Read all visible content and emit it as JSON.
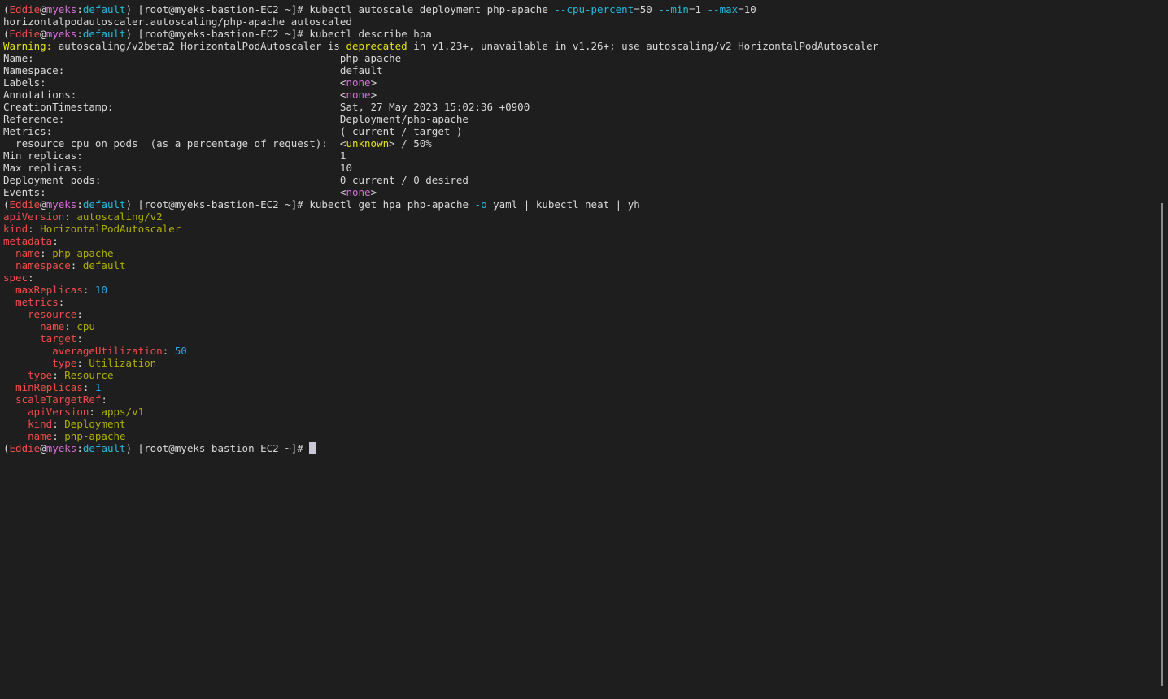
{
  "terminal": {
    "prompt": {
      "open": "(",
      "user": "Eddie",
      "at": "@",
      "cluster": "myeks",
      "colon": ":",
      "namespace": "default",
      "close_path": ") [root@myeks-bastion-EC2 ~]# "
    },
    "cmd1": {
      "base": "kubectl autoscale deployment php-apache ",
      "flag1": "--cpu-percent",
      "val1": "=50 ",
      "flag2": "--min",
      "val2": "=1 ",
      "flag3": "--max",
      "val3": "=10"
    },
    "cmd1_output": "horizontalpodautoscaler.autoscaling/php-apache autoscaled",
    "cmd2": "kubectl describe hpa",
    "warning": {
      "label": "Warning:",
      "text1": " autoscaling/v2beta2 HorizontalPodAutoscaler is ",
      "deprecated": "deprecated",
      "text2": " in v1.23+, unavailable in v1.26+; use autoscaling/v2 HorizontalPodAutoscaler"
    },
    "describe": {
      "name_key": "Name:",
      "name_val": "php-apache",
      "namespace_key": "Namespace:",
      "namespace_val": "default",
      "labels_key": "Labels:",
      "annotations_key": "Annotations:",
      "none_lt": "<",
      "none_word": "none",
      "none_gt": ">",
      "created_key": "CreationTimestamp:",
      "created_val": "Sat, 27 May 2023 15:02:36 +0900",
      "reference_key": "Reference:",
      "reference_val": "Deployment/php-apache",
      "metrics_key": "Metrics:",
      "metrics_val": "( current / target )",
      "resource_key": "  resource cpu on pods  (as a percentage of request):",
      "resource_lt": "<",
      "resource_unknown": "unknown",
      "resource_rest": "> / 50%",
      "min_key": "Min replicas:",
      "min_val": "1",
      "max_key": "Max replicas:",
      "max_val": "10",
      "deploy_pods_key": "Deployment pods:",
      "deploy_pods_val": "0 current / 0 desired",
      "events_key": "Events:"
    },
    "cmd3": {
      "base": "kubectl get hpa php-apache ",
      "flag": "-o",
      "rest": " yaml | kubectl neat | yh"
    },
    "yaml": {
      "apiVersion_key": "apiVersion",
      "apiVersion_val": "autoscaling/v2",
      "kind_key": "kind",
      "kind_val": "HorizontalPodAutoscaler",
      "metadata_key": "metadata",
      "name_key": "name",
      "name_val": "php-apache",
      "namespace_key": "namespace",
      "namespace_val": "default",
      "spec_key": "spec",
      "maxReplicas_key": "maxReplicas",
      "maxReplicas_val": "10",
      "metrics_key": "metrics",
      "dash_resource": "- resource",
      "res_name_key": "name",
      "res_name_val": "cpu",
      "target_key": "target",
      "avgUtil_key": "averageUtilization",
      "avgUtil_val": "50",
      "type_key": "type",
      "type_util_val": "Utilization",
      "type_resource_val": "Resource",
      "minReplicas_key": "minReplicas",
      "minReplicas_val": "1",
      "scaleTargetRef_key": "scaleTargetRef",
      "str_apiVersion_key": "apiVersion",
      "str_apiVersion_val": "apps/v1",
      "str_kind_key": "kind",
      "str_kind_val": "Deployment",
      "str_name_key": "name",
      "str_name_val": "php-apache"
    },
    "colon_sep": ": ",
    "colon_end": ":"
  }
}
